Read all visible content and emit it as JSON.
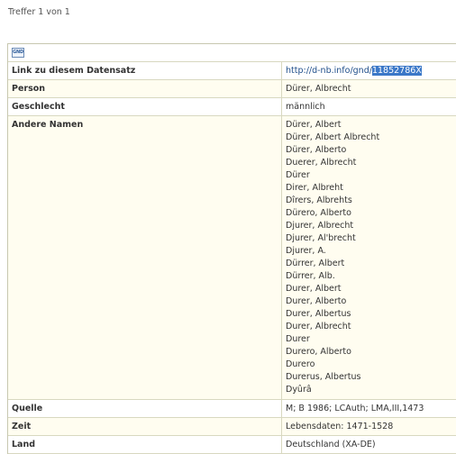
{
  "page": {
    "hits_text": "Treffer 1 von 1",
    "logo_text": "GND"
  },
  "record": {
    "link": {
      "label": "Link zu diesem Datensatz",
      "url_prefix": "http://d-nb.info/gnd/",
      "url_id": "11852786X"
    },
    "person": {
      "label": "Person",
      "value": "Dürer, Albrecht"
    },
    "gender": {
      "label": "Geschlecht",
      "value": "männlich"
    },
    "other_names": {
      "label": "Andere Namen",
      "values": [
        "Dürer, Albert",
        "Dürer, Albert Albrecht",
        "Dürer, Alberto",
        "Duerer, Albrecht",
        "Dürer",
        "Direr, Albreht",
        "Dîrers, Albrehts",
        "Dürero, Alberto",
        "Djurer, Albrecht",
        "Djurer, Al'brecht",
        "Djurer, A.",
        "Dürrer, Albert",
        "Dürrer, Alb.",
        "Durer, Albert",
        "Durer, Alberto",
        "Durer, Albertus",
        "Durer, Albrecht",
        "Durer",
        "Durero, Alberto",
        "Durero",
        "Durerus, Albertus",
        "Dyûrâ"
      ]
    },
    "source": {
      "label": "Quelle",
      "value": "M; B 1986; LCAuth; LMA,III,1473"
    },
    "time": {
      "label": "Zeit",
      "value": "Lebensdaten: 1471-1528"
    },
    "country": {
      "label": "Land",
      "value": "Deutschland (XA-DE)"
    }
  }
}
